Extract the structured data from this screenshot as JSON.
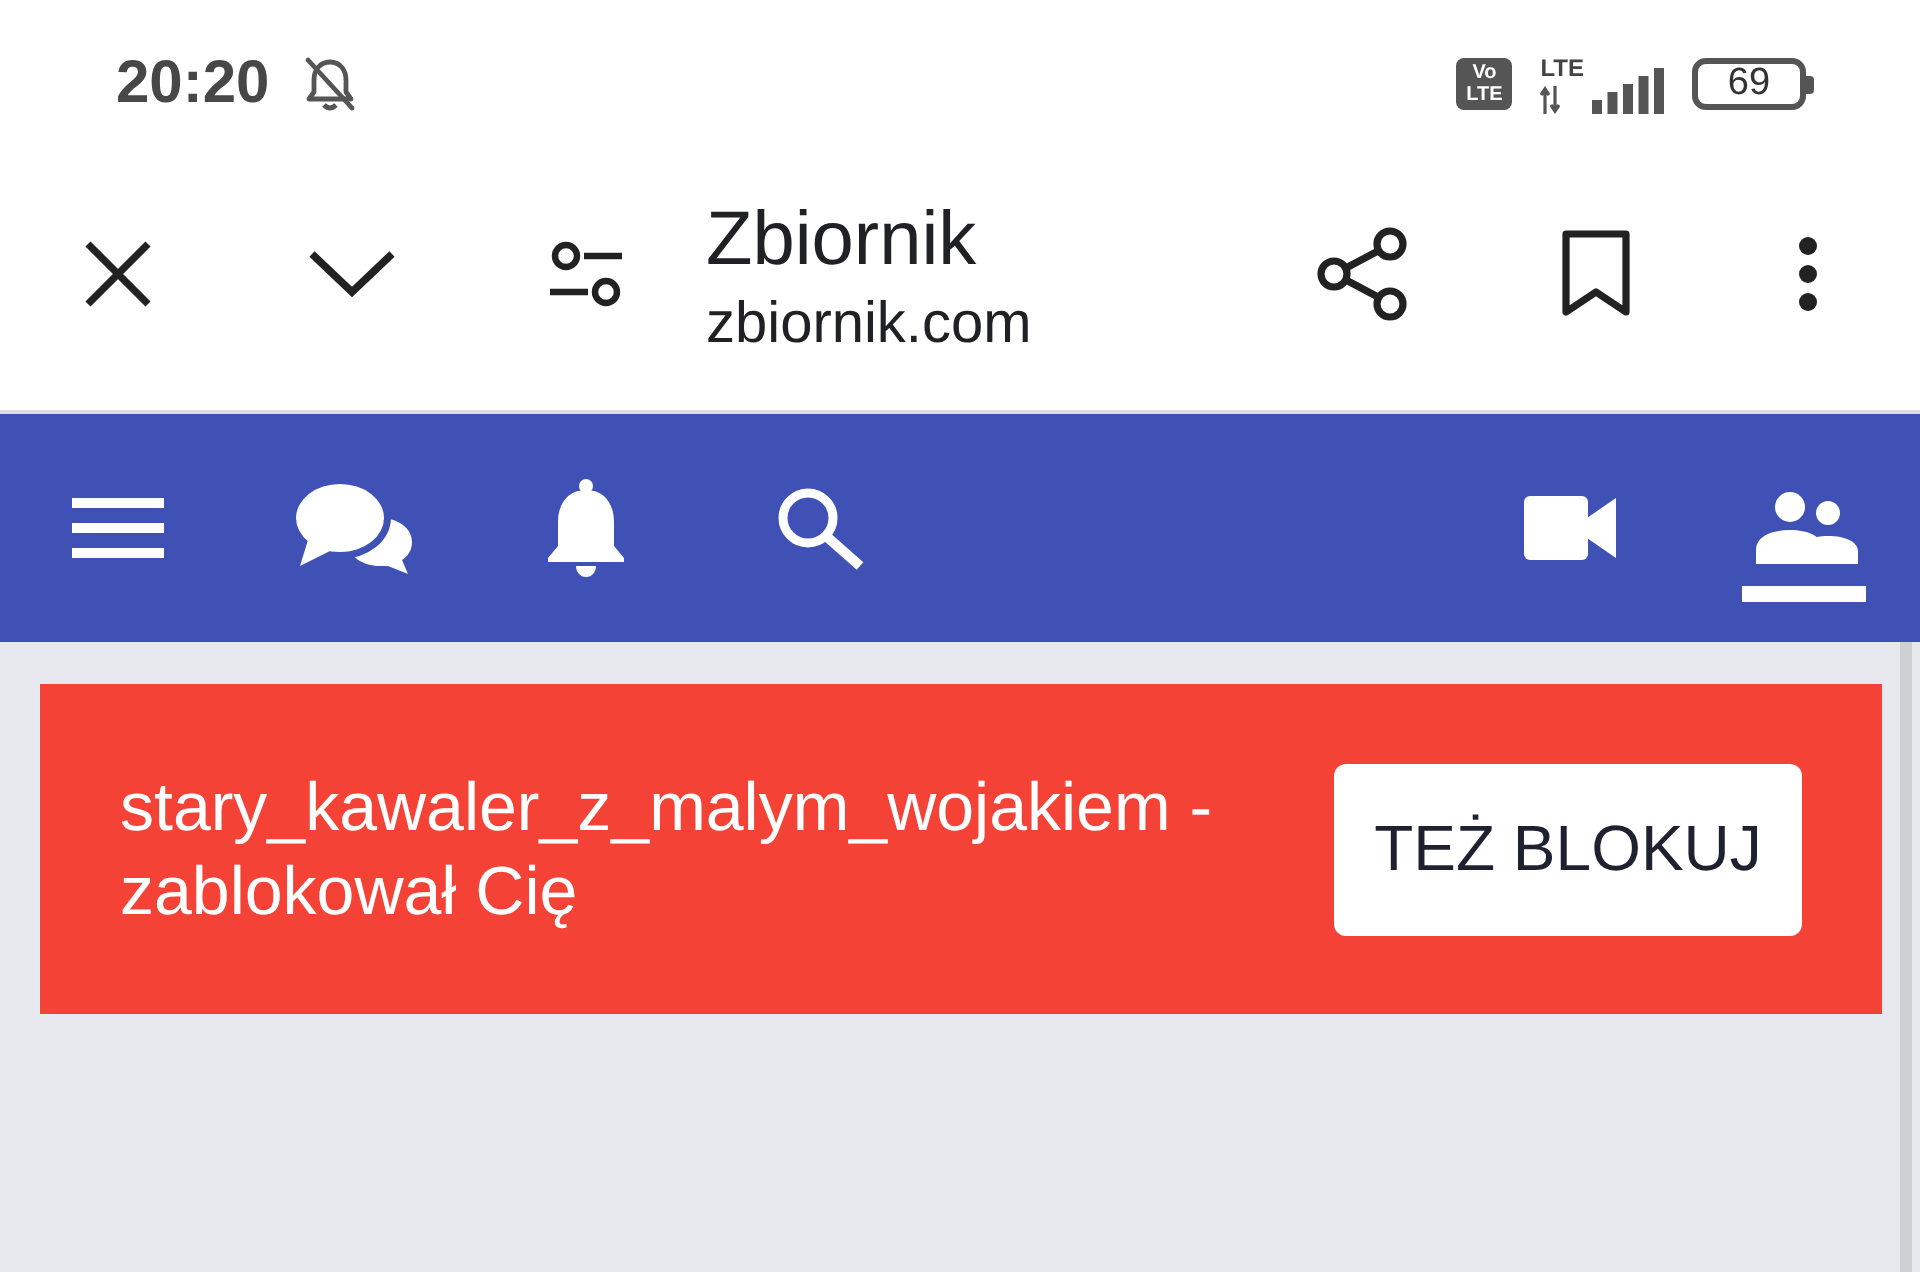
{
  "status_bar": {
    "time": "20:20",
    "volte_badge": "Vo LTE",
    "network_type": "LTE",
    "battery": "69"
  },
  "toolbar": {
    "title": "Zbiornik",
    "url": "zbiornik.com"
  },
  "nav": {
    "items": [
      {
        "selected": false
      },
      {
        "selected": false
      },
      {
        "selected": false
      },
      {
        "selected": false
      },
      {
        "selected": false
      },
      {
        "selected": true
      }
    ]
  },
  "banner": {
    "message": "stary_kawaler_z_malym_wojakiem - zablokował Cię",
    "button": "TEŻ BLOKUJ"
  }
}
